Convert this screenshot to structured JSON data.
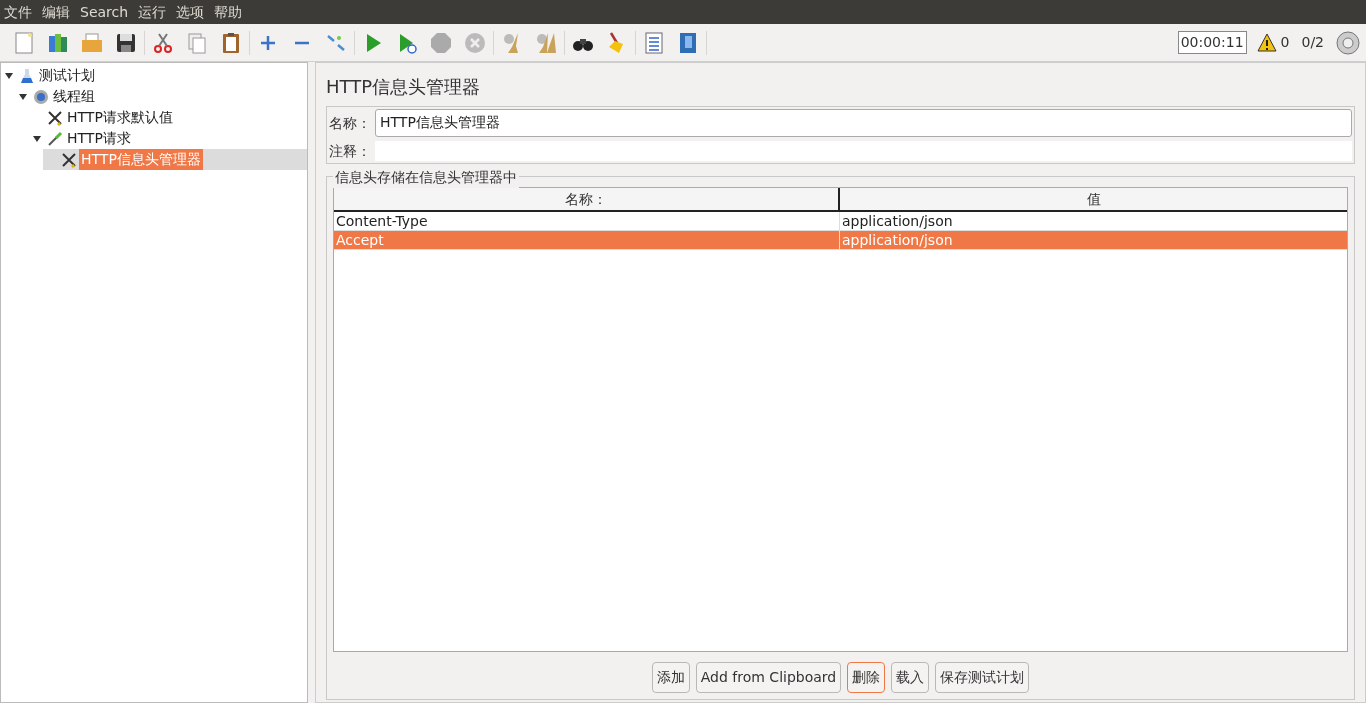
{
  "menu": [
    "文件",
    "编辑",
    "Search",
    "运行",
    "选项",
    "帮助"
  ],
  "toolbar_status": {
    "timer": "00:00:11",
    "warnings": "0",
    "threads": "0/2"
  },
  "tree": [
    {
      "label": "测试计划",
      "kind": "plan",
      "expanded": true,
      "selected": false,
      "children": [
        {
          "label": "线程组",
          "kind": "group",
          "expanded": true,
          "selected": false,
          "children": [
            {
              "label": "HTTP请求默认值",
              "kind": "config",
              "selected": false
            },
            {
              "label": "HTTP请求",
              "kind": "sampler",
              "expanded": true,
              "selected": false,
              "children": [
                {
                  "label": "HTTP信息头管理器",
                  "kind": "config",
                  "selected": true
                }
              ]
            }
          ]
        }
      ]
    }
  ],
  "panel": {
    "title": "HTTP信息头管理器",
    "name_label": "名称：",
    "name_value": "HTTP信息头管理器",
    "comment_label": "注释：",
    "group_title": "信息头存储在信息头管理器中",
    "table": {
      "columns": [
        "名称：",
        "值"
      ],
      "rows": [
        {
          "cells": [
            "Content-Type",
            "application/json"
          ],
          "selected": false
        },
        {
          "cells": [
            "Accept",
            "application/json"
          ],
          "selected": true
        }
      ]
    },
    "buttons": [
      {
        "label": "添加",
        "focused": false
      },
      {
        "label": "Add from Clipboard",
        "focused": false
      },
      {
        "label": "删除",
        "focused": true
      },
      {
        "label": "载入",
        "focused": false
      },
      {
        "label": "保存测试计划",
        "focused": false
      }
    ]
  }
}
